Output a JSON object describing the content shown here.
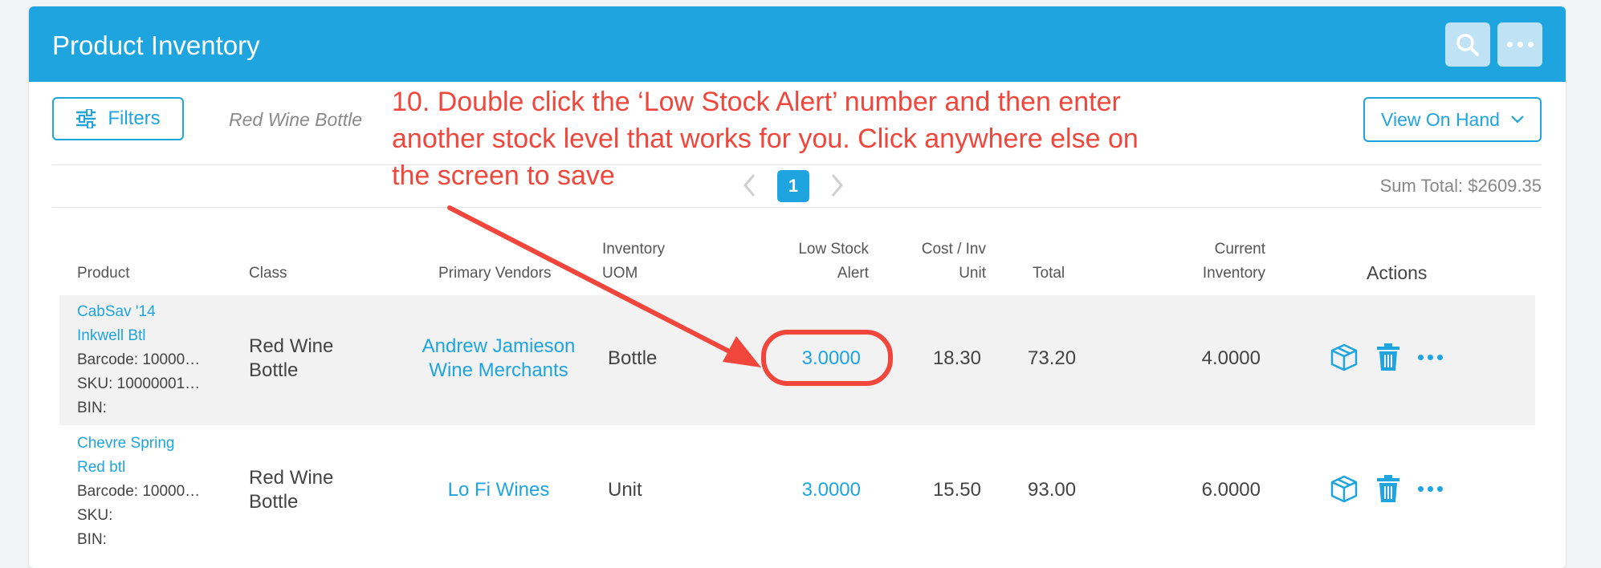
{
  "header": {
    "title": "Product Inventory",
    "search_icon": "search-icon",
    "more_icon": "more-icon"
  },
  "toolbar": {
    "filters_label": "Filters",
    "filter_tag": "Red Wine Bottle",
    "view_label": "View On Hand"
  },
  "pagination": {
    "current": "1",
    "sum_total": "Sum Total: $2609.35"
  },
  "table": {
    "headers": {
      "product": "Product",
      "class": "Class",
      "vendors": "Primary Vendors",
      "uom_1": "Inventory",
      "uom_2": "UOM",
      "low_1": "Low Stock",
      "low_2": "Alert",
      "cost_1": "Cost / Inv",
      "cost_2": "Unit",
      "total": "Total",
      "current_1": "Current",
      "current_2": "Inventory",
      "actions": "Actions"
    },
    "rows": [
      {
        "name_1": "CabSav '14",
        "name_2": "Inkwell Btl",
        "barcode": "Barcode: 10000…",
        "sku": "SKU: 10000001…",
        "bin": "BIN:",
        "class_1": "Red Wine",
        "class_2": "Bottle",
        "vendor_1": "Andrew Jamieson",
        "vendor_2": "Wine Merchants",
        "uom": "Bottle",
        "low_stock": "3.0000",
        "cost": "18.30",
        "total": "73.20",
        "current": "4.0000"
      },
      {
        "name_1": "Chevre Spring",
        "name_2": "Red btl",
        "barcode": "Barcode: 10000…",
        "sku": "SKU:",
        "bin": "BIN:",
        "class_1": "Red Wine",
        "class_2": "Bottle",
        "vendor_1": "Lo Fi Wines",
        "vendor_2": "",
        "uom": "Unit",
        "low_stock": "3.0000",
        "cost": "15.50",
        "total": "93.00",
        "current": "6.0000"
      }
    ]
  },
  "annotation": {
    "line_1": "10. Double click the ‘Low Stock Alert’ number and then enter",
    "line_2": "another stock level that works for you.  Click anywhere else on",
    "line_3": "the screen to save"
  },
  "colors": {
    "accent": "#1ea5df",
    "annotation": "#f0463c"
  }
}
